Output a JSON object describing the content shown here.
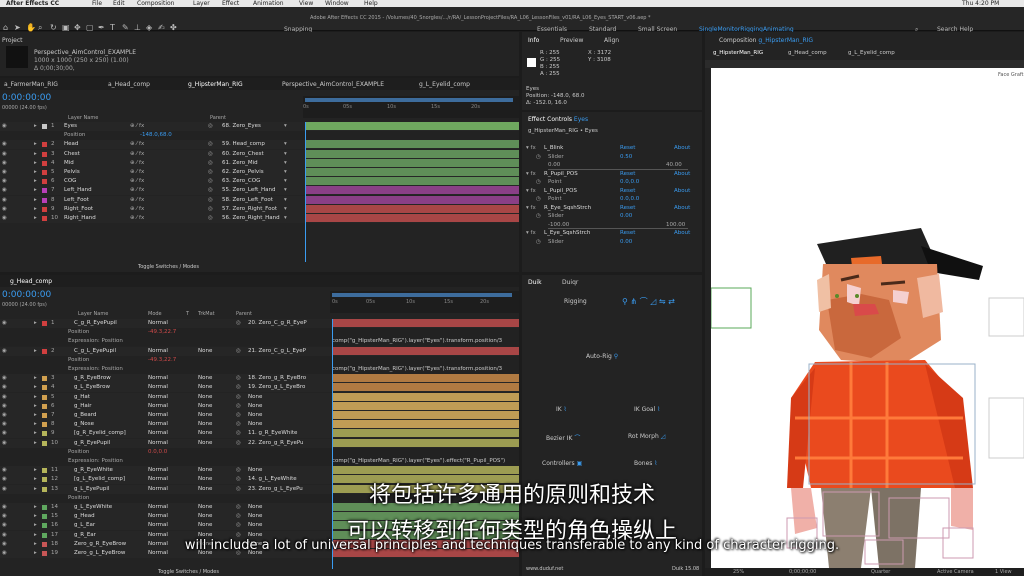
{
  "menubar": {
    "app": "After Effects CC",
    "items": [
      "File",
      "Edit",
      "Composition",
      "Layer",
      "Effect",
      "Animation",
      "View",
      "Window",
      "Help"
    ],
    "clock": "Thu 4:20 PM"
  },
  "window": {
    "title": "Adobe After Effects CC 2015 - /Volumes/40_Snorgles/.../r/RA/_LessonProjectFiles/RA_L06_LessonFiles_v01/RA_L06_Eyes_START_v06.aep *"
  },
  "toolbar": {
    "snapping": "Snapping",
    "workspaces": [
      "Essentials",
      "Standard",
      "Small Screen",
      "SingleMonitorRiggingAnimating"
    ],
    "search": "Search Help"
  },
  "project": {
    "tab": "Project",
    "name": "Perspective_AimControl_EXAMPLE",
    "dims": "1000 x 1000 (250 x 250) (1.00)",
    "dur": "Δ 0;00;30;00,"
  },
  "info": {
    "tabs": [
      "Info",
      "Preview",
      "Align"
    ],
    "r": "R : 255",
    "g": "G : 255",
    "b": "B : 255",
    "a": "A : 255",
    "x": "X : 3172",
    "y": "Y : 3108",
    "layer": "Eyes",
    "pos": "Position: -148.0, 68.0",
    "delta": "Δ: -152.0, 16.0"
  },
  "comp_panel": {
    "label": "Composition",
    "comp": "g_HipsterMan_RIG",
    "tabs": [
      "g_HipsterMan_RIG",
      "g_Head_comp",
      "g_L_Eyelid_comp"
    ],
    "footer": {
      "zoom": "25%",
      "time": "0;00;00;00",
      "res": "Quarter",
      "cam": "Active Camera",
      "views": "1 View"
    },
    "corner": "Face Graft"
  },
  "timeline1": {
    "tabs": [
      "a_FarmerMan_RIG",
      "a_Head_comp",
      "g_HipsterMan_RIG",
      "Perspective_AimControl_EXAMPLE",
      "g_L_Eyelid_comp"
    ],
    "time": "0:00:00:00",
    "fps": "00000 (24.00 fps)",
    "col_layer": "Layer Name",
    "col_parent": "Parent",
    "ruler": [
      "0s",
      "05s",
      "10s",
      "15s",
      "20s"
    ],
    "footer": "Toggle Switches / Modes",
    "rows": [
      {
        "num": "1",
        "name": "Eyes",
        "parent": "68. Zero_Eyes",
        "color": "#c8c8c8",
        "bar": "#6fa85f"
      },
      {
        "num": "",
        "name": "Position",
        "value": "-148.0,68.0",
        "parent": "",
        "color": "",
        "bar": ""
      },
      {
        "num": "2",
        "name": "Head",
        "parent": "59. Head_comp",
        "color": "#d13f3f",
        "bar": "#5f8e58"
      },
      {
        "num": "3",
        "name": "Chest",
        "parent": "60. Zero_Chest",
        "color": "#d13f3f",
        "bar": "#5f8e58"
      },
      {
        "num": "4",
        "name": "Mid",
        "parent": "61. Zero_Mid",
        "color": "#d13f3f",
        "bar": "#5f8e58"
      },
      {
        "num": "5",
        "name": "Pelvis",
        "parent": "62. Zero_Pelvis",
        "color": "#d13f3f",
        "bar": "#5f8e58"
      },
      {
        "num": "6",
        "name": "COG",
        "parent": "63. Zero_COG",
        "color": "#d13f3f",
        "bar": "#5f8e58"
      },
      {
        "num": "7",
        "name": "Left_Hand",
        "parent": "55. Zero_Left_Hand",
        "color": "#b83fb8",
        "bar": "#8a3f86"
      },
      {
        "num": "8",
        "name": "Left_Foot",
        "parent": "58. Zero_Left_Foot",
        "color": "#b83fb8",
        "bar": "#8a3f86"
      },
      {
        "num": "9",
        "name": "Right_Foot",
        "parent": "57. Zero_Right_Foot",
        "color": "#d13f3f",
        "bar": "#a84646"
      },
      {
        "num": "10",
        "name": "Right_Hand",
        "parent": "56. Zero_Right_Hand",
        "color": "#d13f3f",
        "bar": "#a84646"
      }
    ]
  },
  "timeline2": {
    "tab": "g_Head_comp",
    "time": "0:00:00:00",
    "fps": "00000 (24.00 fps)",
    "cols": [
      "Layer Name",
      "Mode",
      "T",
      "TrkMat",
      "Parent"
    ],
    "ruler": [
      "0s",
      "05s",
      "10s",
      "15s",
      "20s"
    ],
    "footer": "Toggle Switches / Modes",
    "rows": [
      {
        "num": "1",
        "name": "C_g_R_EyePupil",
        "mode": "Normal",
        "trk": "",
        "parent": "20. Zero_C_g_R_EyeP",
        "color": "#d13f3f",
        "bar": "#a84646"
      },
      {
        "num": "",
        "name": "Position",
        "value": "-49.3,22.7",
        "parent": "",
        "color": "",
        "bar": ""
      },
      {
        "num": "",
        "name": "Expression: Position",
        "value": "",
        "parent": "",
        "color": "",
        "bar": "",
        "expr": "comp(\"g_HipsterMan_RIG\").layer(\"Eyes\").transform.position/3"
      },
      {
        "num": "2",
        "name": "C_g_L_EyePupil",
        "mode": "Normal",
        "trk": "None",
        "parent": "21. Zero_C_g_L_EyeP",
        "color": "#d13f3f",
        "bar": "#a84646"
      },
      {
        "num": "",
        "name": "Position",
        "value": "-49.3,22.7",
        "parent": "",
        "color": "",
        "bar": ""
      },
      {
        "num": "",
        "name": "Expression: Position",
        "value": "",
        "parent": "",
        "color": "",
        "bar": "",
        "expr": "comp(\"g_HipsterMan_RIG\").layer(\"Eyes\").transform.position/3"
      },
      {
        "num": "3",
        "name": "g_R_EyeBrow",
        "mode": "Normal",
        "trk": "None",
        "parent": "18. Zero_g_R_EyeBro",
        "color": "#d1a04f",
        "bar": "#b07a42"
      },
      {
        "num": "4",
        "name": "g_L_EyeBrow",
        "mode": "Normal",
        "trk": "None",
        "parent": "19. Zero_g_L_EyeBro",
        "color": "#d1a04f",
        "bar": "#b07a42"
      },
      {
        "num": "5",
        "name": "g_Hat",
        "mode": "Normal",
        "trk": "None",
        "parent": "None",
        "color": "#d1a04f",
        "bar": "#c09c55"
      },
      {
        "num": "6",
        "name": "g_Hair",
        "mode": "Normal",
        "trk": "None",
        "parent": "None",
        "color": "#d1a04f",
        "bar": "#c09c55"
      },
      {
        "num": "7",
        "name": "g_Beard",
        "mode": "Normal",
        "trk": "None",
        "parent": "None",
        "color": "#d1a04f",
        "bar": "#c09c55"
      },
      {
        "num": "8",
        "name": "g_Nose",
        "mode": "Normal",
        "trk": "None",
        "parent": "None",
        "color": "#d1a04f",
        "bar": "#c09c55"
      },
      {
        "num": "9",
        "name": "[g_R_Eyelid_comp]",
        "mode": "Normal",
        "trk": "None",
        "parent": "11. g_R_EyeWhite",
        "color": "#b5b55a",
        "bar": "#9c9c52"
      },
      {
        "num": "10",
        "name": "g_R_EyePupil",
        "mode": "Normal",
        "trk": "None",
        "parent": "22. Zero_g_R_EyePu",
        "color": "#b5b55a",
        "bar": "#9c9c52"
      },
      {
        "num": "",
        "name": "Position",
        "value": "0.0,0.0",
        "parent": "",
        "color": "",
        "bar": ""
      },
      {
        "num": "",
        "name": "Expression: Position",
        "value": "",
        "parent": "",
        "color": "",
        "bar": "",
        "expr": "comp(\"g_HipsterMan_RIG\").layer(\"Eyes\").effect(\"R_Pupil_POS\")"
      },
      {
        "num": "11",
        "name": "g_R_EyeWhite",
        "mode": "Normal",
        "trk": "None",
        "parent": "None",
        "color": "#b5b55a",
        "bar": "#9c9c52"
      },
      {
        "num": "12",
        "name": "[g_L_Eyelid_comp]",
        "mode": "Normal",
        "trk": "None",
        "parent": "14. g_L_EyeWhite",
        "color": "#b5b55a",
        "bar": "#9c9c52"
      },
      {
        "num": "13",
        "name": "g_L_EyePupil",
        "mode": "Normal",
        "trk": "None",
        "parent": "23. Zero_g_L_EyePu",
        "color": "#b5b55a",
        "bar": "#9c9c52"
      },
      {
        "num": "",
        "name": "Position",
        "value": "",
        "parent": "",
        "color": "",
        "bar": ""
      },
      {
        "num": "14",
        "name": "g_L_EyeWhite",
        "mode": "Normal",
        "trk": "None",
        "parent": "None",
        "color": "#5fa85f",
        "bar": "#5f8e58"
      },
      {
        "num": "15",
        "name": "g_Head",
        "mode": "Normal",
        "trk": "None",
        "parent": "None",
        "color": "#5fa85f",
        "bar": "#5f8e58"
      },
      {
        "num": "16",
        "name": "g_L_Ear",
        "mode": "Normal",
        "trk": "None",
        "parent": "None",
        "color": "#5fa85f",
        "bar": "#5f8e58"
      },
      {
        "num": "17",
        "name": "g_R_Ear",
        "mode": "Normal",
        "trk": "None",
        "parent": "None",
        "color": "#5fa85f",
        "bar": "#5f8e58"
      },
      {
        "num": "18",
        "name": "Zero_g_R_EyeBrow",
        "mode": "Normal",
        "trk": "None",
        "parent": "None",
        "color": "#c85656",
        "bar": "#a84646"
      },
      {
        "num": "19",
        "name": "Zero_g_L_EyeBrow",
        "mode": "Normal",
        "trk": "None",
        "parent": "None",
        "color": "#c85656",
        "bar": "#a84646"
      }
    ]
  },
  "effects": {
    "title": "Effect Controls",
    "layer": "Eyes",
    "path": "g_HipsterMan_RIG • Eyes",
    "items": [
      {
        "name": "L_Blink",
        "reset": "Reset",
        "about": "About",
        "sub": "Slider",
        "val": "0.50",
        "min": "0.00",
        "max": "40.00"
      },
      {
        "name": "R_Pupil_POS",
        "reset": "Reset",
        "about": "About",
        "sub": "Point",
        "val": "0.0,0.0"
      },
      {
        "name": "L_Pupil_POS",
        "reset": "Reset",
        "about": "About",
        "sub": "Point",
        "val": "0.0,0.0"
      },
      {
        "name": "R_Eye_SqshStrch",
        "reset": "Reset",
        "about": "About",
        "sub": "Slider",
        "val": "0.00",
        "min": "-100.00",
        "max": "100.00"
      },
      {
        "name": "L_Eye_SqshStrch",
        "reset": "Reset",
        "about": "About",
        "sub": "Slider",
        "val": "0.00"
      }
    ]
  },
  "duik": {
    "tabs": [
      "Duik",
      "Duiqr"
    ],
    "rigging": "Rigging",
    "autorig": "Auto-Rig",
    "ik": "IK",
    "ikgoal": "IK Goal",
    "bezier": "Bezier IK",
    "rotmorph": "Rot Morph",
    "controllers": "Controllers",
    "bones": "Bones",
    "site": "www.duduf.net",
    "version": "Duik 15.08"
  },
  "subtitles": {
    "zh_line1": "将包括许多通用的原则和技术",
    "zh_line2": "可以转移到任何类型的角色操纵上",
    "en": "will include a lot of universal principles and techniques transferable to any kind of character rigging."
  }
}
